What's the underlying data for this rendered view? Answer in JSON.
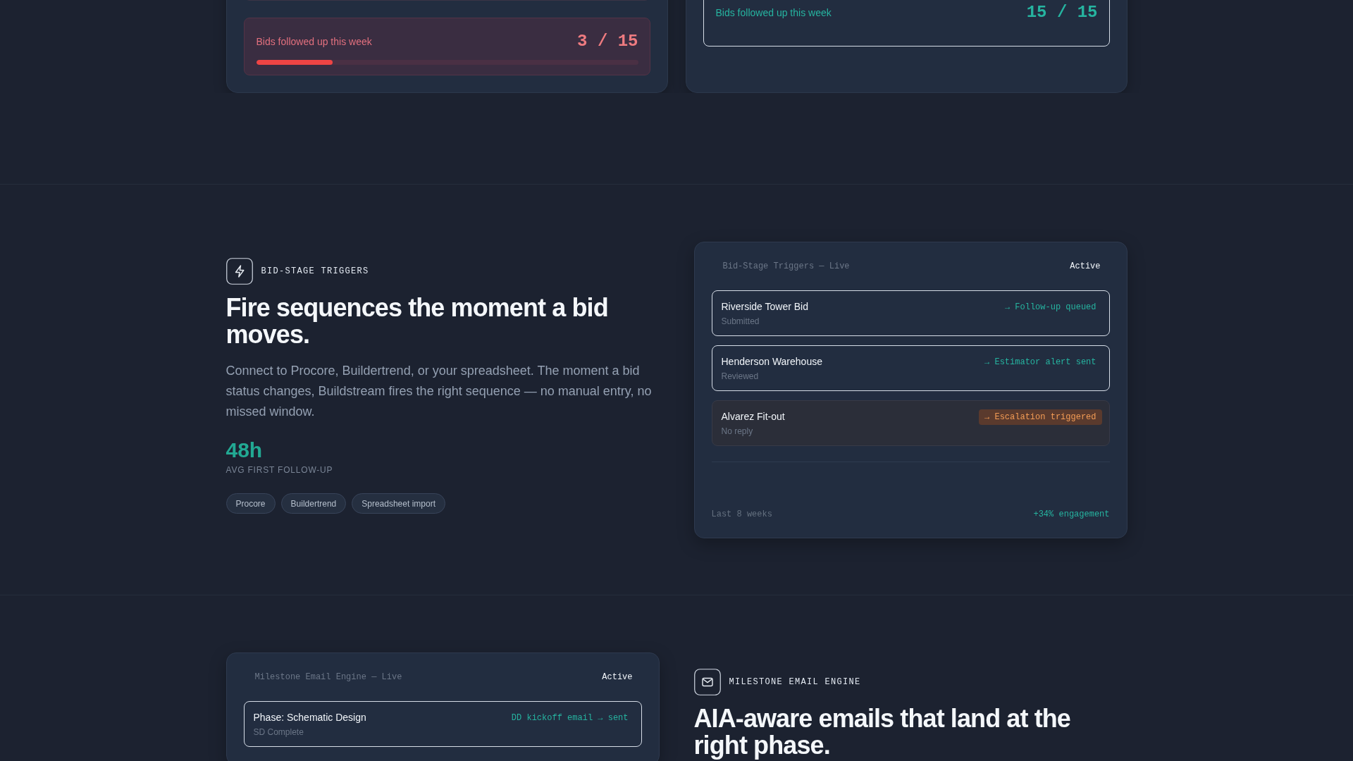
{
  "summary_cards": [
    {
      "stat": {
        "label": "Bids followed up this week",
        "value": "3 / 15",
        "on_track": false,
        "highlighted": false,
        "level": 0.2
      }
    },
    {
      "stat": {
        "label": "Bids followed up this week",
        "value": "15 / 15",
        "on_track": true,
        "highlighted": true
      }
    }
  ],
  "sections": [
    {
      "kind": "triggers",
      "feature": {
        "eyebrow": "BID-STAGE TRIGGERS",
        "headline": "Fire sequences the moment a bid moves.",
        "description": "Connect to Procore, Buildertrend, or your spreadsheet. The moment a bid status changes, Buildstream fires the right sequence — no manual entry, no missed window.",
        "metric": {
          "value": "48h",
          "label": "AVG FIRST FOLLOW-UP"
        },
        "integrations": [
          "Procore",
          "Buildertrend",
          "Spreadsheet import"
        ]
      },
      "panel": {
        "title": "Bid-Stage Triggers — Live",
        "status": "Active",
        "rows": [
          {
            "title": "Riverside Tower Bid",
            "subtitle": "Submitted",
            "action": "→ Follow-up queued",
            "highlighted": true,
            "escalated": false
          },
          {
            "title": "Henderson Warehouse",
            "subtitle": "Reviewed",
            "action": "→ Estimator alert sent",
            "highlighted": true,
            "escalated": false
          },
          {
            "title": "Alvarez Fit-out",
            "subtitle": "No reply",
            "action": "→ Escalation triggered",
            "highlighted": false,
            "escalated": true
          }
        ],
        "footer": {
          "period": "Last 8 weeks",
          "change": "+34% engagement"
        }
      }
    },
    {
      "kind": "milestones",
      "feature": {
        "eyebrow": "MILESTONE EMAIL ENGINE",
        "headline": "AIA-aware emails that land at the right phase."
      },
      "panel": {
        "title": "Milestone Email Engine — Live",
        "status": "Active",
        "rows": [
          {
            "title": "Phase: Schematic Design",
            "subtitle": "SD Complete",
            "action": "DD kickoff email → sent",
            "highlighted": true,
            "escalated": false
          }
        ]
      }
    }
  ]
}
